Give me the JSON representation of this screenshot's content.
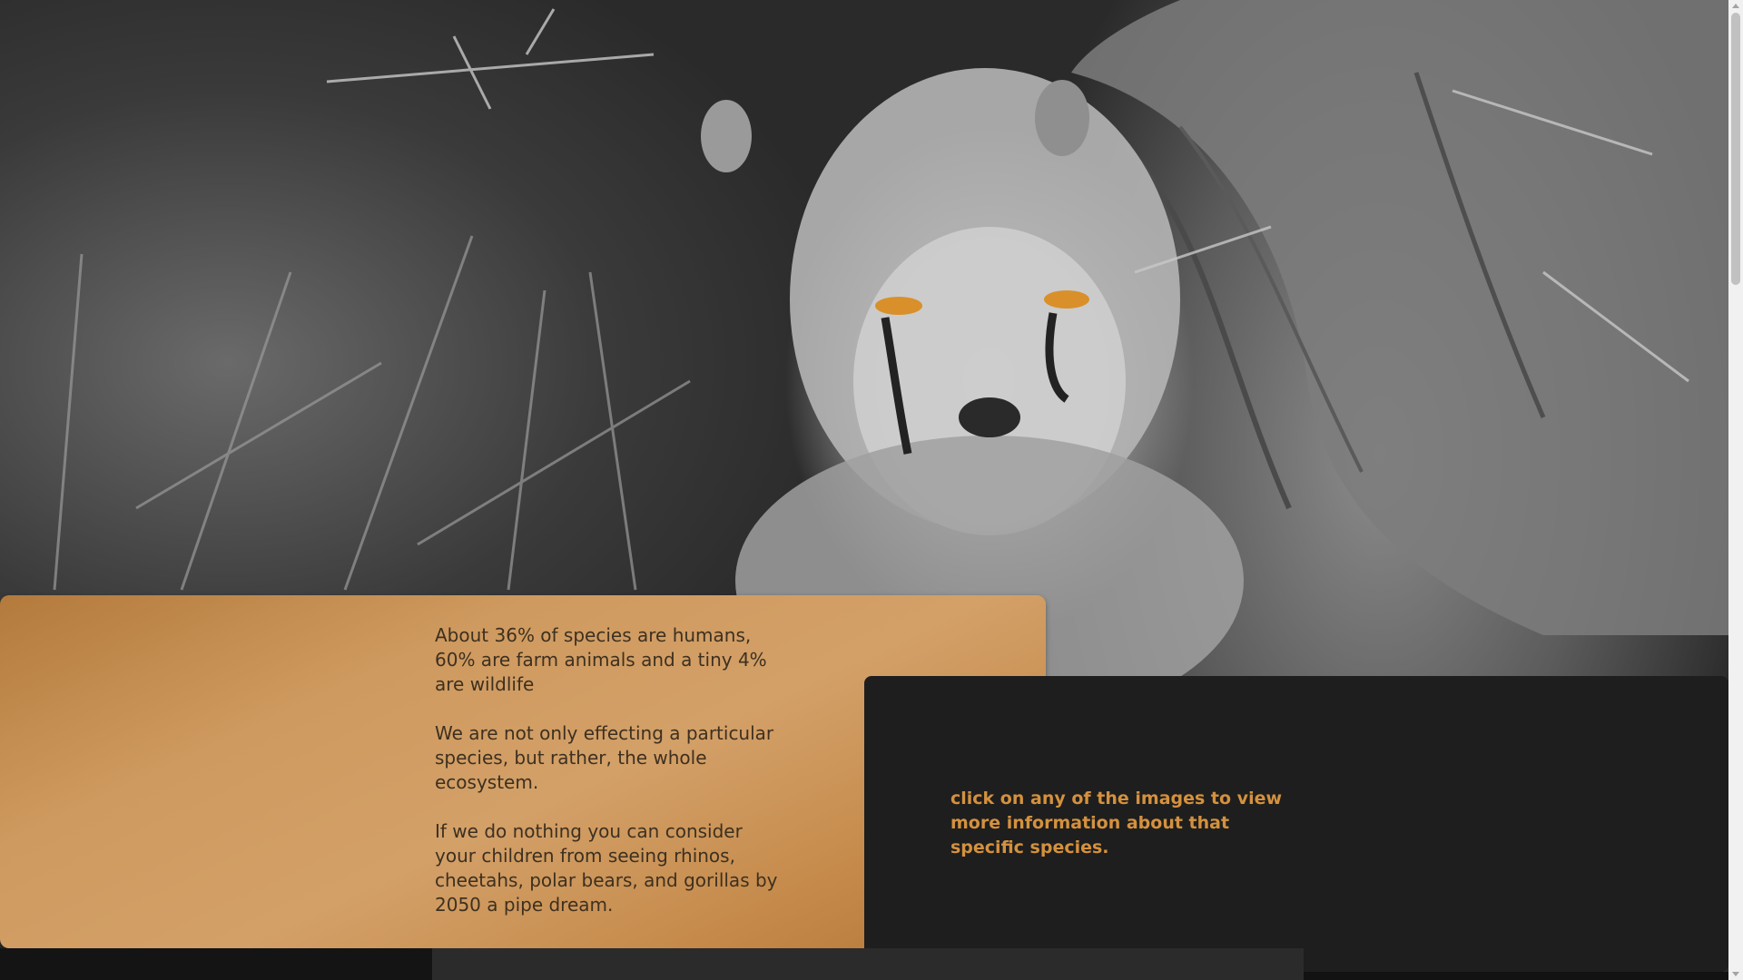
{
  "hero": {
    "image": "cheetah-cub-photo",
    "tint": "grayscale",
    "eye_color": "#d9902a"
  },
  "info_card": {
    "accent": "#c9935a",
    "paragraphs": [
      "About 36% of species are humans, 60% are farm animals and a tiny 4% are wildlife",
      "We are not only effecting a particular species, but rather, the whole ecosystem.",
      "If we do nothing you can consider your children from seeing rhinos, cheetahs, polar bears, and gorillas by 2050 a pipe dream."
    ]
  },
  "dark_card": {
    "note": "click on any of the images to view more information about that specific species.",
    "note_color": "#d4913e"
  }
}
